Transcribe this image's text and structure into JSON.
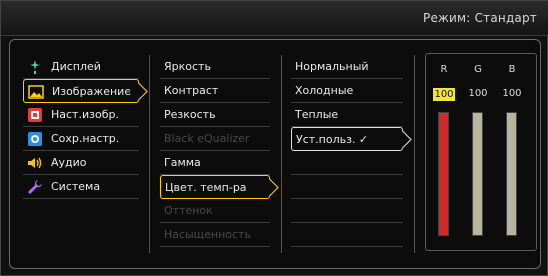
{
  "mode_text": "Режим: Стандарт",
  "main_menu": [
    {
      "label": "Дисплей",
      "icon": "display-icon"
    },
    {
      "label": "Изображение",
      "icon": "picture-icon"
    },
    {
      "label": "Наст.изобр.",
      "icon": "picture-settings-icon"
    },
    {
      "label": "Сохр.настр.",
      "icon": "save-settings-icon"
    },
    {
      "label": "Аудио",
      "icon": "speaker-icon"
    },
    {
      "label": "Система",
      "icon": "wrench-icon"
    }
  ],
  "picture_menu": [
    {
      "label": "Яркость"
    },
    {
      "label": "Контраст"
    },
    {
      "label": "Резкость"
    },
    {
      "label": "Black eQualizer"
    },
    {
      "label": "Гамма"
    },
    {
      "label": "Цвет. темп-ра"
    },
    {
      "label": "Оттенок"
    },
    {
      "label": "Насыщенность"
    }
  ],
  "color_temp_menu": [
    {
      "label": "Нормальный"
    },
    {
      "label": "Холодные"
    },
    {
      "label": "Теплые"
    },
    {
      "label": "Уст.польз. ✓"
    }
  ],
  "rgb": {
    "labels": [
      "R",
      "G",
      "B"
    ],
    "values": [
      "100",
      "100",
      "100"
    ],
    "colors": [
      "#d4282a",
      "#b7b59e",
      "#b7b59e"
    ]
  },
  "colors": {
    "selected_border": "#ffd200",
    "value_focus": "#f4e53a"
  }
}
